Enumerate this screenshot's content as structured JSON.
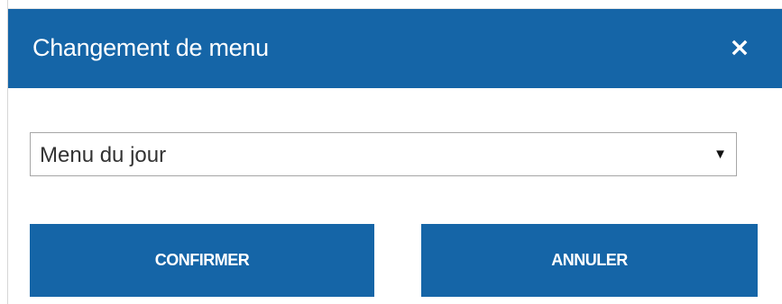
{
  "dialog": {
    "title": "Changement de menu",
    "close_icon": "close-icon"
  },
  "menu_select": {
    "selected_value": "Menu du jour",
    "arrow_glyph": "▼"
  },
  "actions": {
    "confirm_label": "CONFIRMER",
    "cancel_label": "ANNULER"
  },
  "colors": {
    "accent": "#1565a7",
    "text_on_accent": "#ffffff"
  }
}
